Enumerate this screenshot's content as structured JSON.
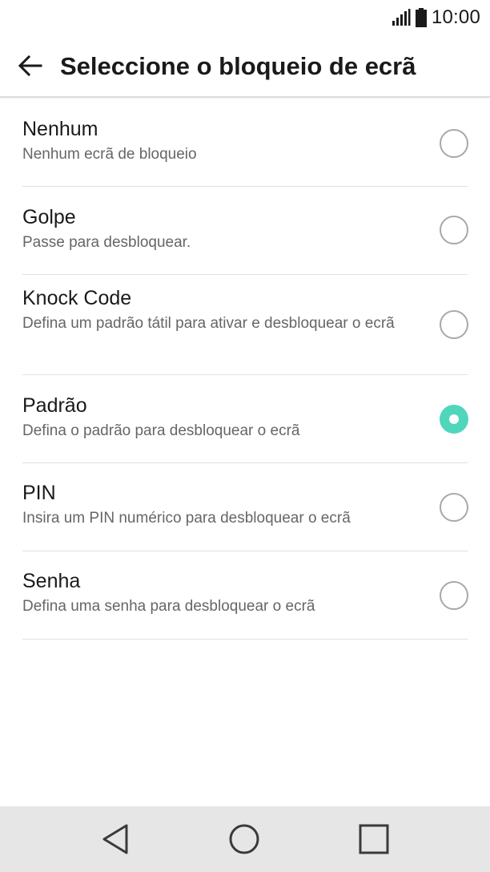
{
  "status_bar": {
    "time": "10:00",
    "icons": [
      "signal-icon",
      "battery-icon"
    ]
  },
  "header": {
    "back_icon": "arrow-left-icon",
    "title": "Seleccione o bloqueio de ecrã"
  },
  "options": [
    {
      "title": "Nenhum",
      "description": "Nenhum ecrã de bloqueio",
      "selected": false
    },
    {
      "title": "Golpe",
      "description": "Passe para desbloquear.",
      "selected": false
    },
    {
      "title": "Knock Code",
      "description": "Defina um padrão tátil para ativar e desbloquear o ecrã",
      "selected": false
    },
    {
      "title": "Padrão",
      "description": "Defina o padrão para desbloquear o ecrã",
      "selected": true
    },
    {
      "title": "PIN",
      "description": "Insira um PIN numérico para desbloquear o ecrã",
      "selected": false
    },
    {
      "title": "Senha",
      "description": "Defina uma senha para desbloquear o ecrã",
      "selected": false
    }
  ],
  "nav_bar": {
    "icons": [
      "back-triangle-icon",
      "home-circle-icon",
      "recents-square-icon"
    ]
  },
  "colors": {
    "accent": "#4fd6bb",
    "nav_bg": "#e6e6e6",
    "divider": "#e0e0e0"
  }
}
